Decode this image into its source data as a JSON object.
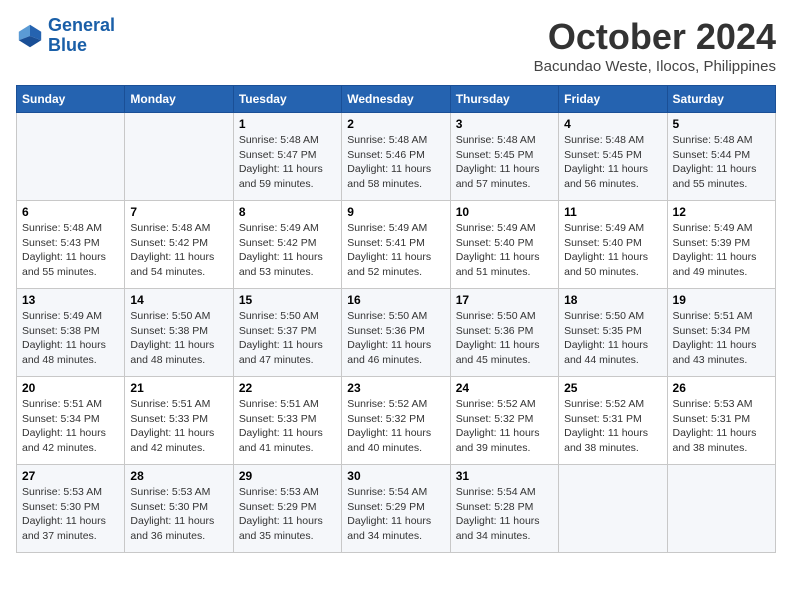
{
  "logo": {
    "line1": "General",
    "line2": "Blue"
  },
  "title": "October 2024",
  "location": "Bacundao Weste, Ilocos, Philippines",
  "weekdays": [
    "Sunday",
    "Monday",
    "Tuesday",
    "Wednesday",
    "Thursday",
    "Friday",
    "Saturday"
  ],
  "weeks": [
    [
      {
        "day": "",
        "sunrise": "",
        "sunset": "",
        "daylight": ""
      },
      {
        "day": "",
        "sunrise": "",
        "sunset": "",
        "daylight": ""
      },
      {
        "day": "1",
        "sunrise": "Sunrise: 5:48 AM",
        "sunset": "Sunset: 5:47 PM",
        "daylight": "Daylight: 11 hours and 59 minutes."
      },
      {
        "day": "2",
        "sunrise": "Sunrise: 5:48 AM",
        "sunset": "Sunset: 5:46 PM",
        "daylight": "Daylight: 11 hours and 58 minutes."
      },
      {
        "day": "3",
        "sunrise": "Sunrise: 5:48 AM",
        "sunset": "Sunset: 5:45 PM",
        "daylight": "Daylight: 11 hours and 57 minutes."
      },
      {
        "day": "4",
        "sunrise": "Sunrise: 5:48 AM",
        "sunset": "Sunset: 5:45 PM",
        "daylight": "Daylight: 11 hours and 56 minutes."
      },
      {
        "day": "5",
        "sunrise": "Sunrise: 5:48 AM",
        "sunset": "Sunset: 5:44 PM",
        "daylight": "Daylight: 11 hours and 55 minutes."
      }
    ],
    [
      {
        "day": "6",
        "sunrise": "Sunrise: 5:48 AM",
        "sunset": "Sunset: 5:43 PM",
        "daylight": "Daylight: 11 hours and 55 minutes."
      },
      {
        "day": "7",
        "sunrise": "Sunrise: 5:48 AM",
        "sunset": "Sunset: 5:42 PM",
        "daylight": "Daylight: 11 hours and 54 minutes."
      },
      {
        "day": "8",
        "sunrise": "Sunrise: 5:49 AM",
        "sunset": "Sunset: 5:42 PM",
        "daylight": "Daylight: 11 hours and 53 minutes."
      },
      {
        "day": "9",
        "sunrise": "Sunrise: 5:49 AM",
        "sunset": "Sunset: 5:41 PM",
        "daylight": "Daylight: 11 hours and 52 minutes."
      },
      {
        "day": "10",
        "sunrise": "Sunrise: 5:49 AM",
        "sunset": "Sunset: 5:40 PM",
        "daylight": "Daylight: 11 hours and 51 minutes."
      },
      {
        "day": "11",
        "sunrise": "Sunrise: 5:49 AM",
        "sunset": "Sunset: 5:40 PM",
        "daylight": "Daylight: 11 hours and 50 minutes."
      },
      {
        "day": "12",
        "sunrise": "Sunrise: 5:49 AM",
        "sunset": "Sunset: 5:39 PM",
        "daylight": "Daylight: 11 hours and 49 minutes."
      }
    ],
    [
      {
        "day": "13",
        "sunrise": "Sunrise: 5:49 AM",
        "sunset": "Sunset: 5:38 PM",
        "daylight": "Daylight: 11 hours and 48 minutes."
      },
      {
        "day": "14",
        "sunrise": "Sunrise: 5:50 AM",
        "sunset": "Sunset: 5:38 PM",
        "daylight": "Daylight: 11 hours and 48 minutes."
      },
      {
        "day": "15",
        "sunrise": "Sunrise: 5:50 AM",
        "sunset": "Sunset: 5:37 PM",
        "daylight": "Daylight: 11 hours and 47 minutes."
      },
      {
        "day": "16",
        "sunrise": "Sunrise: 5:50 AM",
        "sunset": "Sunset: 5:36 PM",
        "daylight": "Daylight: 11 hours and 46 minutes."
      },
      {
        "day": "17",
        "sunrise": "Sunrise: 5:50 AM",
        "sunset": "Sunset: 5:36 PM",
        "daylight": "Daylight: 11 hours and 45 minutes."
      },
      {
        "day": "18",
        "sunrise": "Sunrise: 5:50 AM",
        "sunset": "Sunset: 5:35 PM",
        "daylight": "Daylight: 11 hours and 44 minutes."
      },
      {
        "day": "19",
        "sunrise": "Sunrise: 5:51 AM",
        "sunset": "Sunset: 5:34 PM",
        "daylight": "Daylight: 11 hours and 43 minutes."
      }
    ],
    [
      {
        "day": "20",
        "sunrise": "Sunrise: 5:51 AM",
        "sunset": "Sunset: 5:34 PM",
        "daylight": "Daylight: 11 hours and 42 minutes."
      },
      {
        "day": "21",
        "sunrise": "Sunrise: 5:51 AM",
        "sunset": "Sunset: 5:33 PM",
        "daylight": "Daylight: 11 hours and 42 minutes."
      },
      {
        "day": "22",
        "sunrise": "Sunrise: 5:51 AM",
        "sunset": "Sunset: 5:33 PM",
        "daylight": "Daylight: 11 hours and 41 minutes."
      },
      {
        "day": "23",
        "sunrise": "Sunrise: 5:52 AM",
        "sunset": "Sunset: 5:32 PM",
        "daylight": "Daylight: 11 hours and 40 minutes."
      },
      {
        "day": "24",
        "sunrise": "Sunrise: 5:52 AM",
        "sunset": "Sunset: 5:32 PM",
        "daylight": "Daylight: 11 hours and 39 minutes."
      },
      {
        "day": "25",
        "sunrise": "Sunrise: 5:52 AM",
        "sunset": "Sunset: 5:31 PM",
        "daylight": "Daylight: 11 hours and 38 minutes."
      },
      {
        "day": "26",
        "sunrise": "Sunrise: 5:53 AM",
        "sunset": "Sunset: 5:31 PM",
        "daylight": "Daylight: 11 hours and 38 minutes."
      }
    ],
    [
      {
        "day": "27",
        "sunrise": "Sunrise: 5:53 AM",
        "sunset": "Sunset: 5:30 PM",
        "daylight": "Daylight: 11 hours and 37 minutes."
      },
      {
        "day": "28",
        "sunrise": "Sunrise: 5:53 AM",
        "sunset": "Sunset: 5:30 PM",
        "daylight": "Daylight: 11 hours and 36 minutes."
      },
      {
        "day": "29",
        "sunrise": "Sunrise: 5:53 AM",
        "sunset": "Sunset: 5:29 PM",
        "daylight": "Daylight: 11 hours and 35 minutes."
      },
      {
        "day": "30",
        "sunrise": "Sunrise: 5:54 AM",
        "sunset": "Sunset: 5:29 PM",
        "daylight": "Daylight: 11 hours and 34 minutes."
      },
      {
        "day": "31",
        "sunrise": "Sunrise: 5:54 AM",
        "sunset": "Sunset: 5:28 PM",
        "daylight": "Daylight: 11 hours and 34 minutes."
      },
      {
        "day": "",
        "sunrise": "",
        "sunset": "",
        "daylight": ""
      },
      {
        "day": "",
        "sunrise": "",
        "sunset": "",
        "daylight": ""
      }
    ]
  ]
}
